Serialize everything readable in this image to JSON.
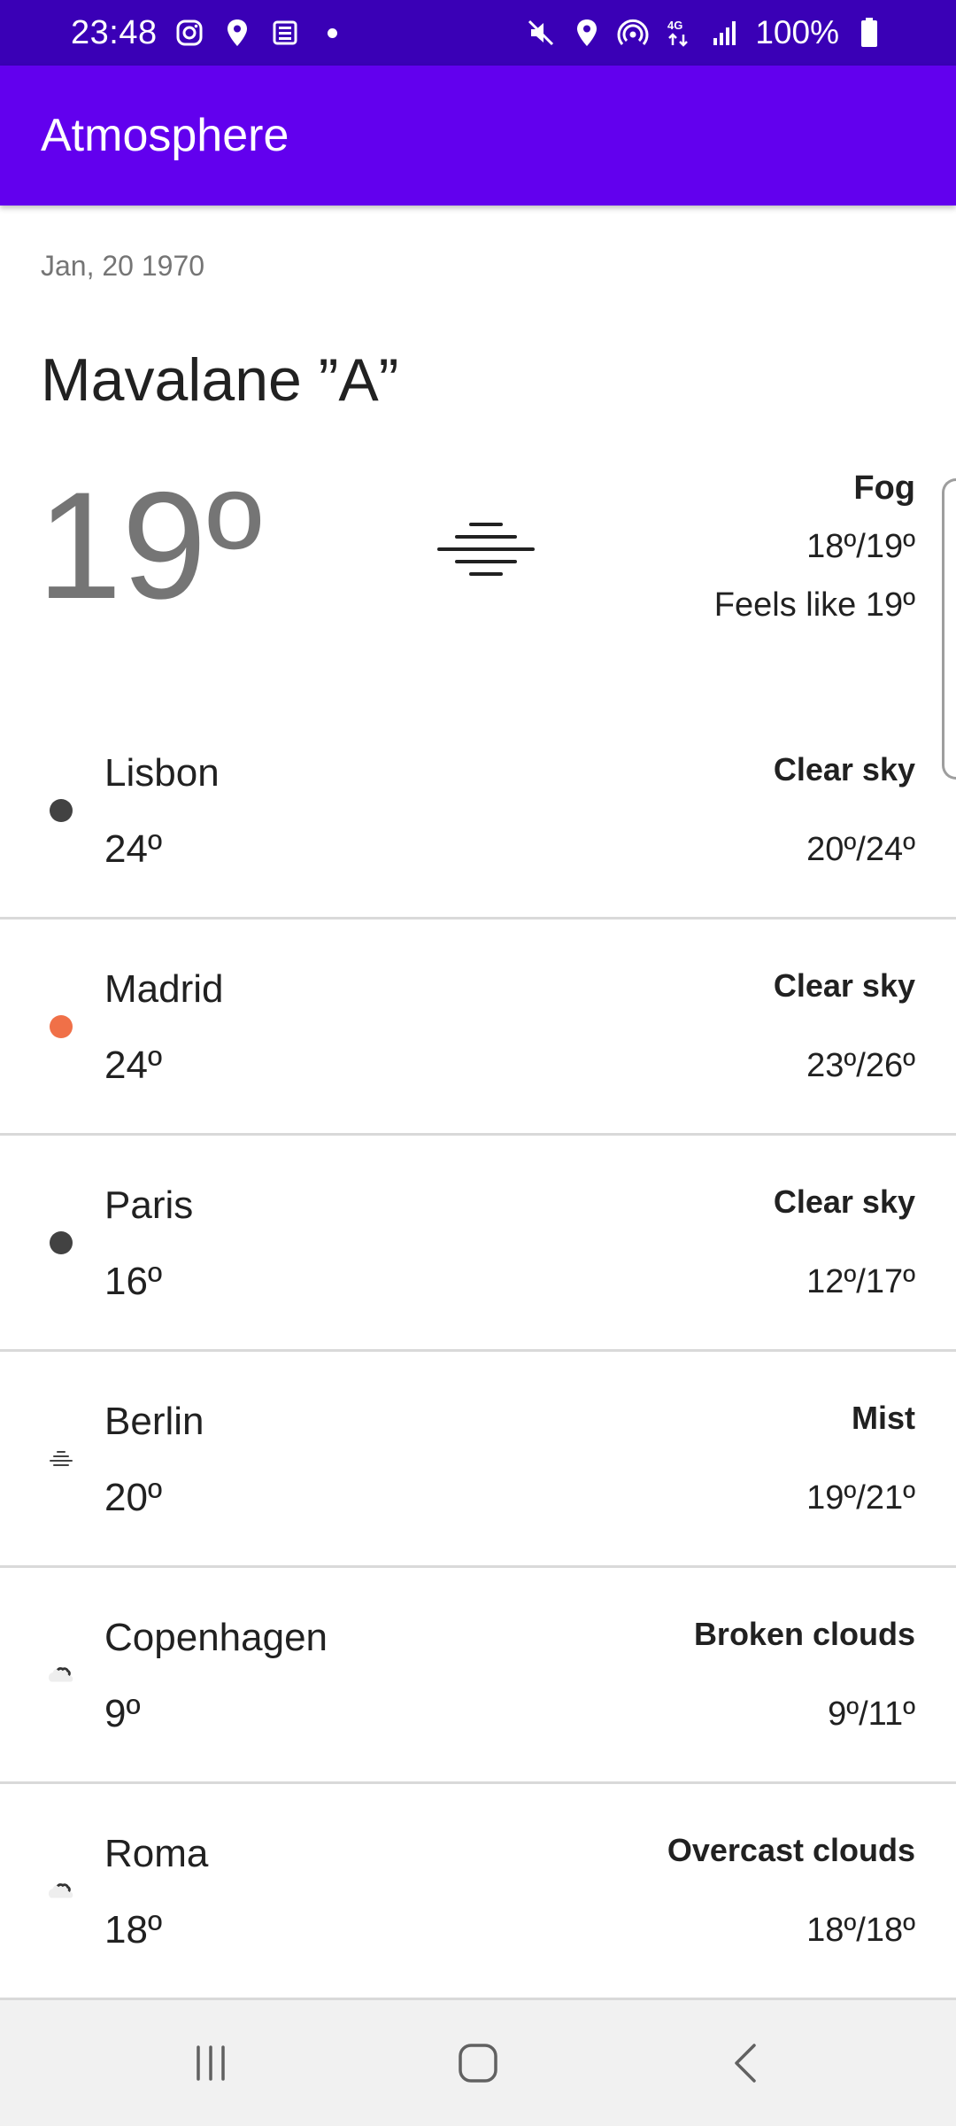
{
  "status_bar": {
    "time": "23:48",
    "battery": "100%",
    "left_icons": [
      "instagram-icon",
      "location-icon",
      "news-icon",
      "dot-icon"
    ],
    "right_icons": [
      "mute-icon",
      "location-icon",
      "hotspot-icon",
      "4g-icon",
      "signal-icon",
      "battery-icon"
    ]
  },
  "app_bar": {
    "title": "Atmosphere",
    "color": "#6200ee"
  },
  "current": {
    "date": "Jan, 20 1970",
    "location": "Mavalane ”A”",
    "temperature": "19º",
    "description": "Fog",
    "range": "18º/19º",
    "feels_like": "Feels like 19º",
    "icon": "fog-icon"
  },
  "cities": [
    {
      "name": "Lisbon",
      "temp": "24º",
      "desc": "Clear sky",
      "range": "20º/24º",
      "icon": "dot-icon",
      "color": "#424242"
    },
    {
      "name": "Madrid",
      "temp": "24º",
      "desc": "Clear sky",
      "range": "23º/26º",
      "icon": "dot-icon",
      "color": "#f07048"
    },
    {
      "name": "Paris",
      "temp": "16º",
      "desc": "Clear sky",
      "range": "12º/17º",
      "icon": "dot-icon",
      "color": "#424242"
    },
    {
      "name": "Berlin",
      "temp": "20º",
      "desc": "Mist",
      "range": "19º/21º",
      "icon": "mist-icon",
      "color": "#424242"
    },
    {
      "name": "Copenhagen",
      "temp": "9º",
      "desc": "Broken clouds",
      "range": "9º/11º",
      "icon": "cloud-icon",
      "color": "#424242"
    },
    {
      "name": "Roma",
      "temp": "18º",
      "desc": "Overcast clouds",
      "range": "18º/18º",
      "icon": "cloud-icon",
      "color": "#424242"
    }
  ],
  "nav_bar": {
    "buttons": [
      "recents-icon",
      "home-icon",
      "back-icon"
    ]
  }
}
